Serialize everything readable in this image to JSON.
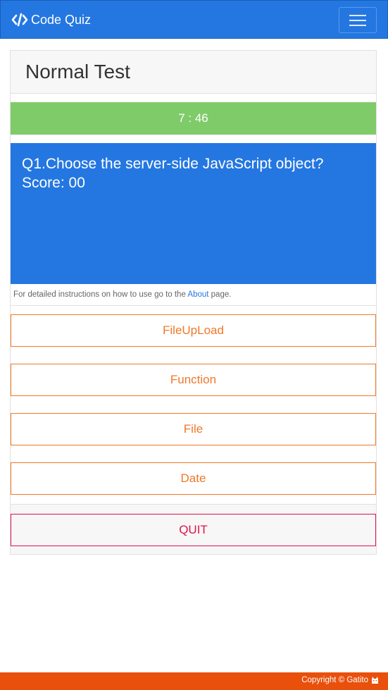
{
  "navbar": {
    "brand_icon": "code-icon",
    "brand_label": "Code Quiz",
    "toggler_icon": "hamburger-icon",
    "color": "#2477e1"
  },
  "card": {
    "title": "Normal Test"
  },
  "timer": {
    "text": "7 : 46",
    "color": "#7fcb6a"
  },
  "question": {
    "text": "Q1.Choose the server-side JavaScript object?",
    "score": "Score: 00",
    "color": "#2477e1"
  },
  "instructions": {
    "prefix": "For detailed instructions on how to use go to the ",
    "link": "About",
    "suffix": " page."
  },
  "answers": [
    "FileUpLoad",
    "Function",
    "File",
    "Date"
  ],
  "answer_color": "#f07828",
  "quit": {
    "label": "QUIT",
    "color": "#e0124d"
  },
  "footer": {
    "text": "Copyright © Gatito",
    "icon": "cat-icon",
    "color": "#e8500c"
  }
}
